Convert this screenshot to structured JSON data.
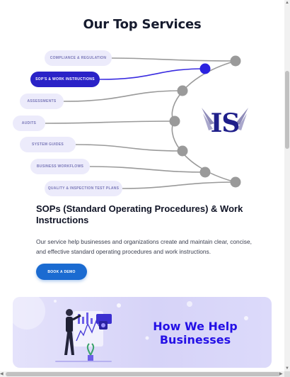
{
  "section": {
    "title": "Our Top Services"
  },
  "services": [
    {
      "label": "Compliance & Regulation",
      "active": false
    },
    {
      "label": "SOP's & Work Instructions",
      "active": true
    },
    {
      "label": "Assessments",
      "active": false
    },
    {
      "label": "Audits",
      "active": false
    },
    {
      "label": "System Guides",
      "active": false
    },
    {
      "label": "Business Workflows",
      "active": false
    },
    {
      "label": "Quality & Inspection Test Plans",
      "active": false
    }
  ],
  "logo": {
    "text": "IS"
  },
  "detail": {
    "title": "SOPs (Standard Operating Procedures) & Work Instructions",
    "description": "Our service help businesses and organizations create and maintain clear, concise, and effective standard operating procedures and work instructions.",
    "button_label": "Book a Demo"
  },
  "card": {
    "heading": "How We Help Businesses"
  },
  "colors": {
    "active": "#2a22c7",
    "pill": "#ecebfb",
    "connector": "#9a9a9a",
    "button": "#1b6bd1",
    "heading_accent": "#2410e6"
  }
}
